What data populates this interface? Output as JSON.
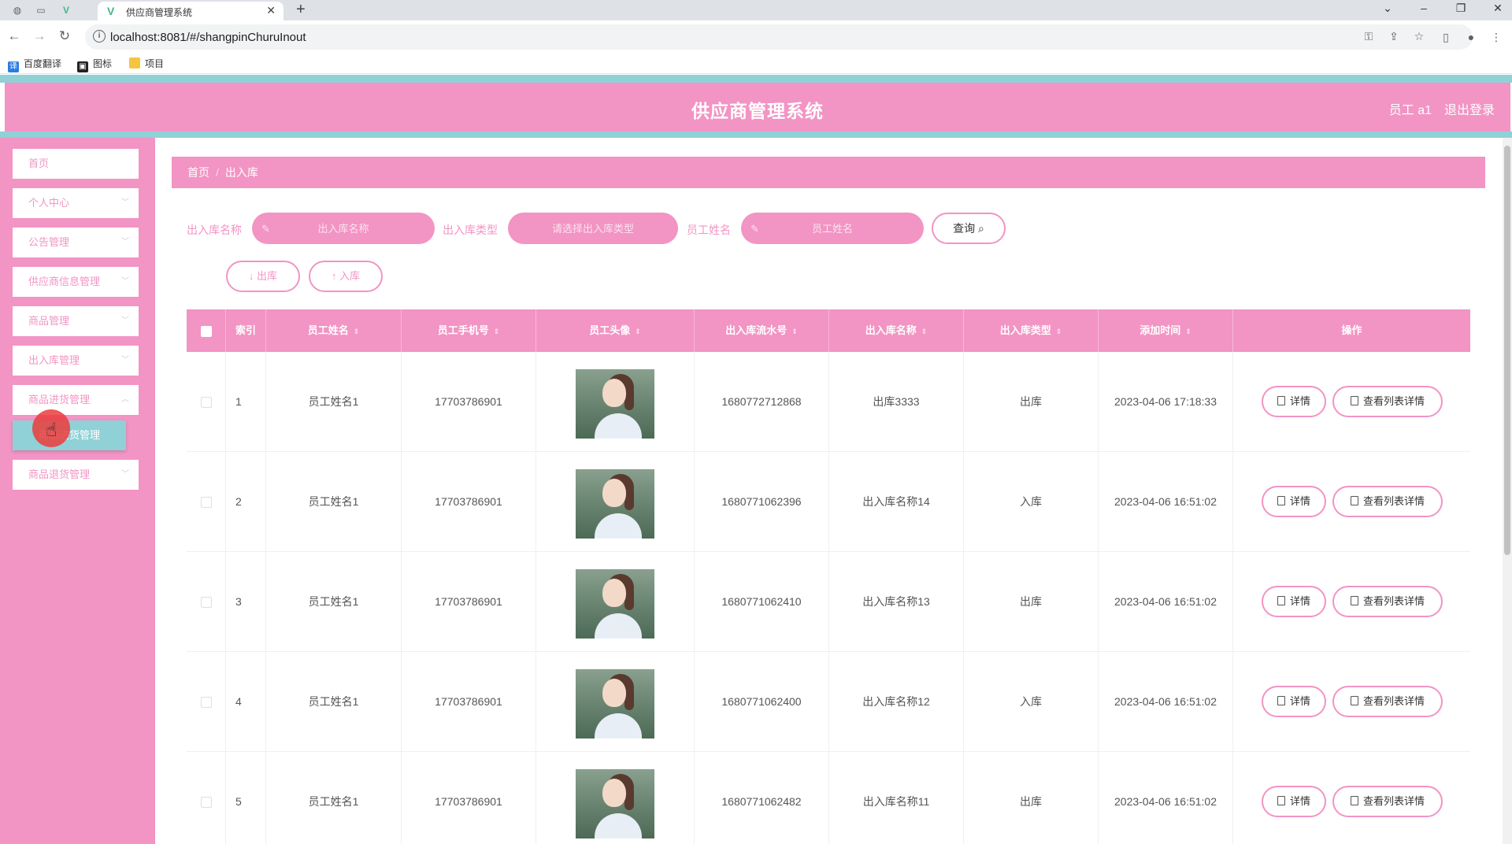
{
  "browser": {
    "tab_title": "供应商管理系统",
    "url": "localhost:8081/#/shangpinChuruInout",
    "bookmarks": [
      "百度翻译",
      "图标",
      "项目"
    ]
  },
  "header": {
    "title": "供应商管理系统",
    "user": "员工 a1",
    "logout": "退出登录"
  },
  "sidebar": {
    "items": [
      "首页",
      "个人中心",
      "公告管理",
      "供应商信息管理",
      "商品管理",
      "出入库管理",
      "商品进货管理",
      "商品退货管理"
    ],
    "submenu_item": "商品进货管理"
  },
  "breadcrumb": {
    "home": "首页",
    "current": "出入库"
  },
  "search": {
    "name_label": "出入库名称",
    "name_placeholder": "出入库名称",
    "type_label": "出入库类型",
    "type_placeholder": "请选择出入库类型",
    "staff_label": "员工姓名",
    "staff_placeholder": "员工姓名",
    "query": "查询"
  },
  "actions": {
    "out": "出库",
    "in": "入库"
  },
  "table": {
    "headers": [
      "索引",
      "员工姓名",
      "员工手机号",
      "员工头像",
      "出入库流水号",
      "出入库名称",
      "出入库类型",
      "添加时间",
      "操作"
    ],
    "detail_label": "详情",
    "list_detail_label": "查看列表详情",
    "rows": [
      {
        "index": "1",
        "name": "员工姓名1",
        "phone": "17703786901",
        "serial": "1680772712868",
        "item_name": "出库3333",
        "type": "出库",
        "time": "2023-04-06 17:18:33"
      },
      {
        "index": "2",
        "name": "员工姓名1",
        "phone": "17703786901",
        "serial": "1680771062396",
        "item_name": "出入库名称14",
        "type": "入库",
        "time": "2023-04-06 16:51:02"
      },
      {
        "index": "3",
        "name": "员工姓名1",
        "phone": "17703786901",
        "serial": "1680771062410",
        "item_name": "出入库名称13",
        "type": "出库",
        "time": "2023-04-06 16:51:02"
      },
      {
        "index": "4",
        "name": "员工姓名1",
        "phone": "17703786901",
        "serial": "1680771062400",
        "item_name": "出入库名称12",
        "type": "入库",
        "time": "2023-04-06 16:51:02"
      },
      {
        "index": "5",
        "name": "员工姓名1",
        "phone": "17703786901",
        "serial": "1680771062482",
        "item_name": "出入库名称11",
        "type": "出库",
        "time": "2023-04-06 16:51:02"
      }
    ]
  },
  "colors": {
    "primary": "#f294c4",
    "accent": "#8fd1d6"
  }
}
